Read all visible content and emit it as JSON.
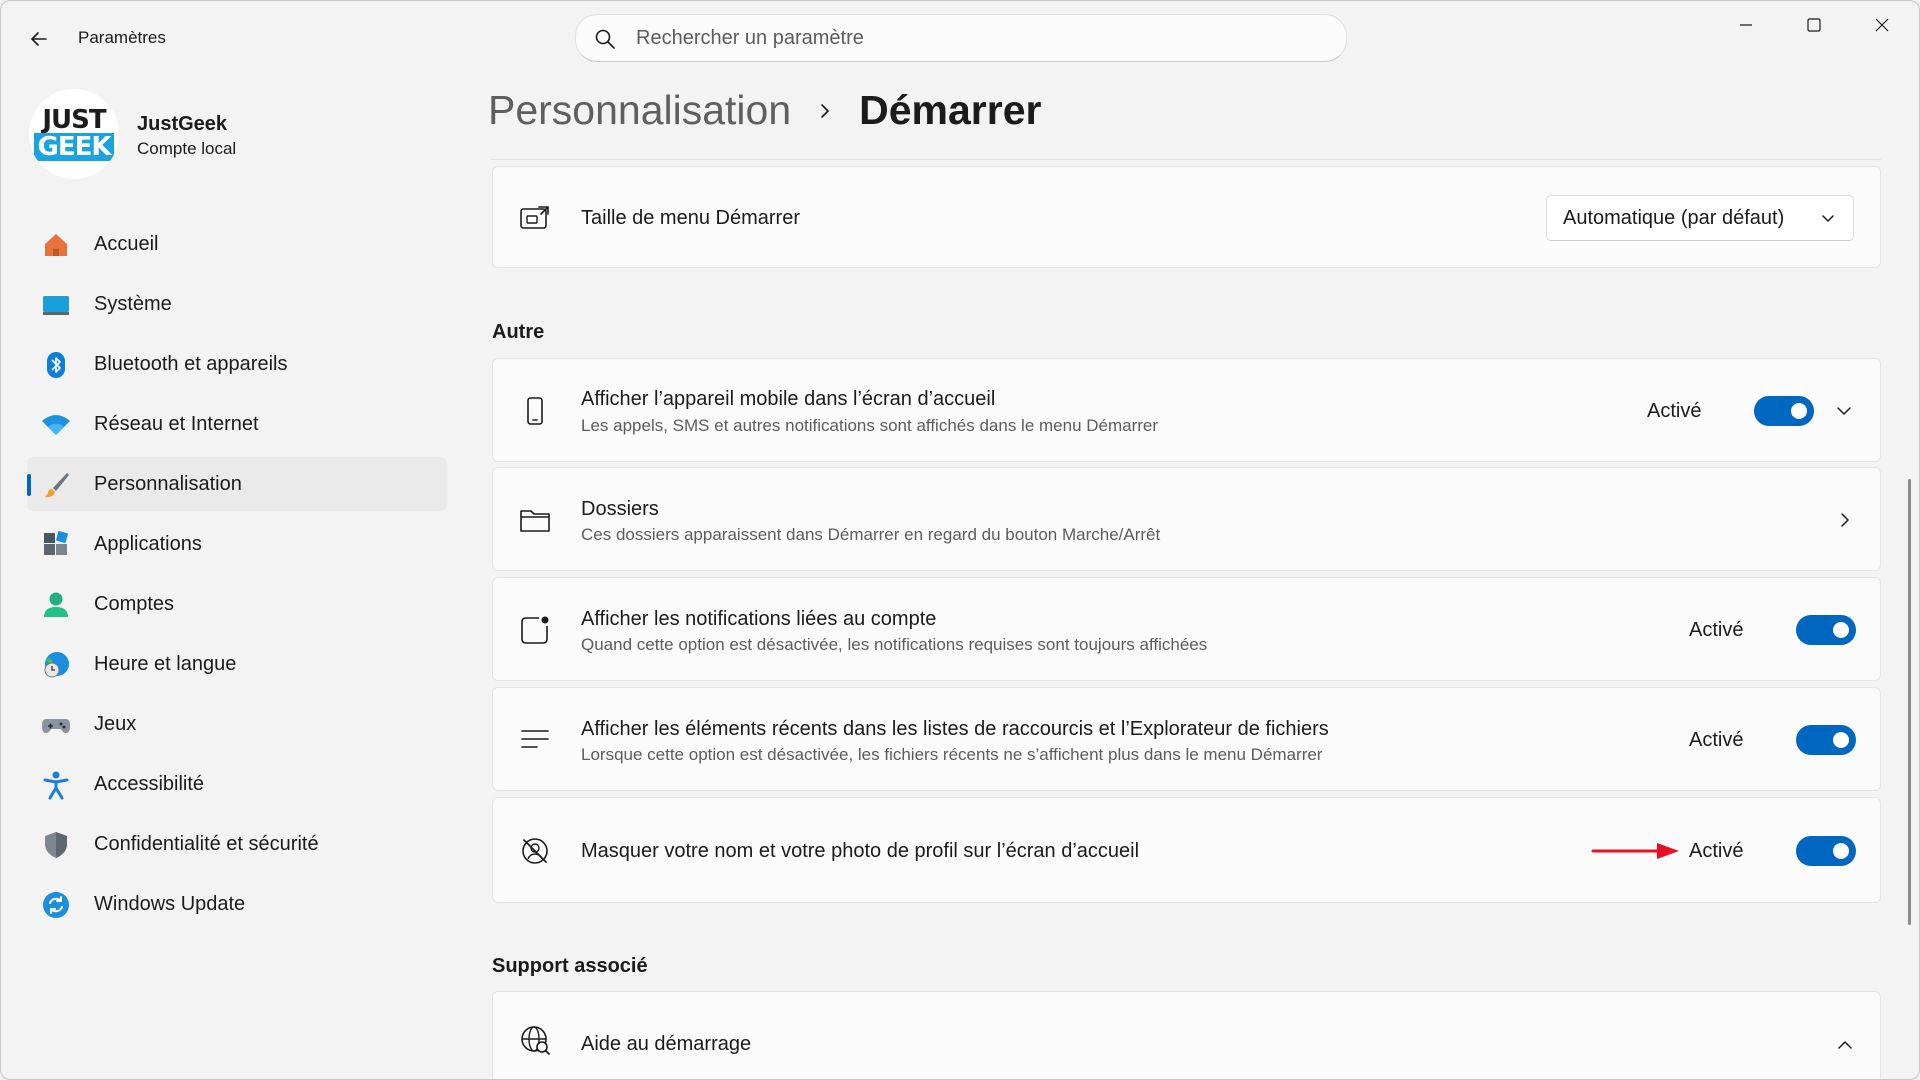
{
  "window": {
    "app_title": "Paramètres",
    "search_placeholder": "Rechercher un paramètre"
  },
  "profile": {
    "logo_top": "JUST",
    "logo_bottom": "GEEK",
    "name": "JustGeek",
    "account_type": "Compte local"
  },
  "sidebar": {
    "items": [
      {
        "label": "Accueil",
        "icon": "home-icon"
      },
      {
        "label": "Système",
        "icon": "system-icon"
      },
      {
        "label": "Bluetooth et appareils",
        "icon": "bluetooth-icon"
      },
      {
        "label": "Réseau et Internet",
        "icon": "wifi-icon"
      },
      {
        "label": "Personnalisation",
        "icon": "brush-icon",
        "active": true
      },
      {
        "label": "Applications",
        "icon": "apps-icon"
      },
      {
        "label": "Comptes",
        "icon": "account-icon"
      },
      {
        "label": "Heure et langue",
        "icon": "time-language-icon"
      },
      {
        "label": "Jeux",
        "icon": "gamepad-icon"
      },
      {
        "label": "Accessibilité",
        "icon": "accessibility-icon"
      },
      {
        "label": "Confidentialité et sécurité",
        "icon": "shield-icon"
      },
      {
        "label": "Windows Update",
        "icon": "update-icon"
      }
    ]
  },
  "breadcrumb": {
    "parent": "Personnalisation",
    "current": "Démarrer"
  },
  "main": {
    "menu_size": {
      "title": "Taille de menu Démarrer",
      "value": "Automatique (par défaut)"
    },
    "section_other": "Autre",
    "settings": [
      {
        "title": "Afficher l’appareil mobile dans l’écran d’accueil",
        "desc": "Les appels, SMS et autres notifications sont affichés dans le menu Démarrer",
        "state": "Activé",
        "on": true
      },
      {
        "title": "Dossiers",
        "desc": "Ces dossiers apparaissent dans Démarrer en regard du bouton Marche/Arrêt"
      },
      {
        "title": "Afficher les notifications liées au compte",
        "desc": "Quand cette option est désactivée, les notifications requises sont toujours affichées",
        "state": "Activé",
        "on": true
      },
      {
        "title": "Afficher les éléments récents dans les listes de raccourcis et l’Explorateur de fichiers",
        "desc": "Lorsque cette option est désactivée, les fichiers récents ne s’affichent plus dans le menu Démarrer",
        "state": "Activé",
        "on": true
      },
      {
        "title": "Masquer votre nom et votre photo de profil sur l’écran d’accueil",
        "state": "Activé",
        "on": true
      }
    ],
    "section_support": "Support associé",
    "help": {
      "title": "Aide au démarrage"
    }
  },
  "colors": {
    "accent": "#0067c0",
    "annotation_arrow": "#e81123"
  }
}
